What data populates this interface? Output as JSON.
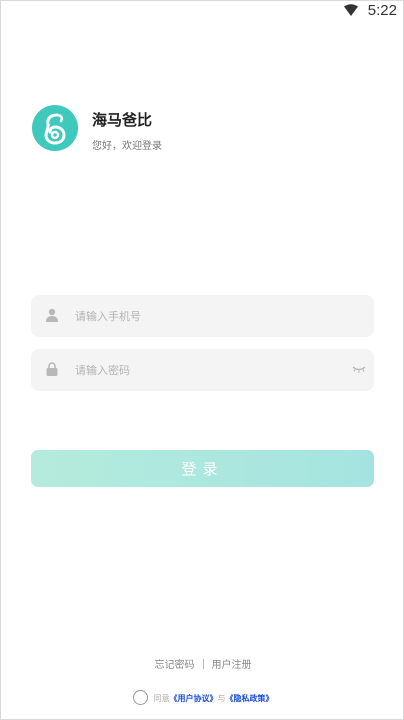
{
  "status_bar": {
    "time": "5:22",
    "wifi_icon": "wifi-icon"
  },
  "brand": {
    "app_name": "海马爸比",
    "greeting": "您好，欢迎登录",
    "logo_color": "#3fc9bd"
  },
  "form": {
    "phone_placeholder": "请输入手机号",
    "phone_value": "",
    "password_placeholder": "请输入密码",
    "password_value": "",
    "login_label": "登录",
    "login_color": "#a8e6dd"
  },
  "links": {
    "forgot_password": "忘记密码",
    "register": "用户注册"
  },
  "agreement": {
    "prefix": "同意",
    "user_agreement": "《用户协议》",
    "conjunction": "与",
    "privacy_policy": "《隐私政策》",
    "link_color": "#1d4fd8"
  }
}
